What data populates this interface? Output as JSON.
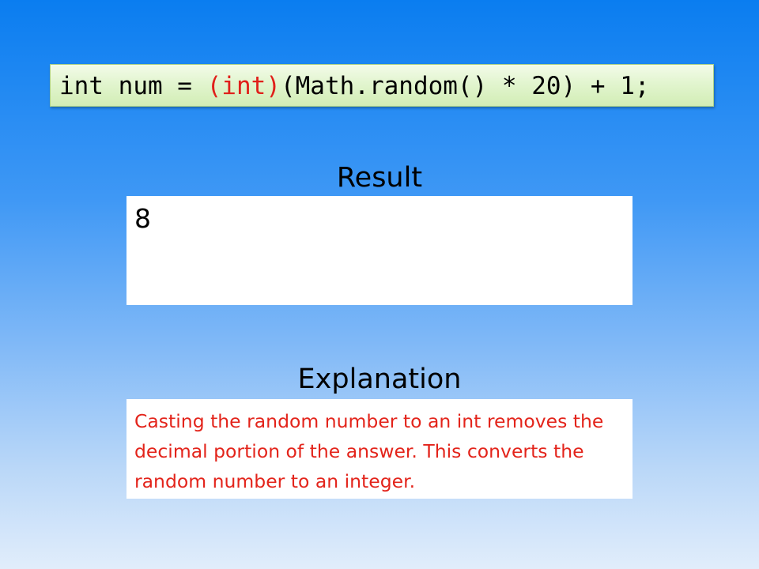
{
  "code": {
    "prefix": "int num = ",
    "cast": "(int)",
    "suffix": "(Math.random() * 20) + 1;"
  },
  "result": {
    "title": "Result",
    "value": "8"
  },
  "explanation": {
    "title": "Explanation",
    "text": "Casting the random number to an int removes the decimal portion of the answer. This converts the random number to an integer."
  },
  "colors": {
    "background_top": "#0a7df0",
    "background_bottom": "#e1edfb",
    "code_box": "#e2f5cf",
    "cast_highlight": "#e0201a",
    "explanation_text": "#e3241b"
  }
}
